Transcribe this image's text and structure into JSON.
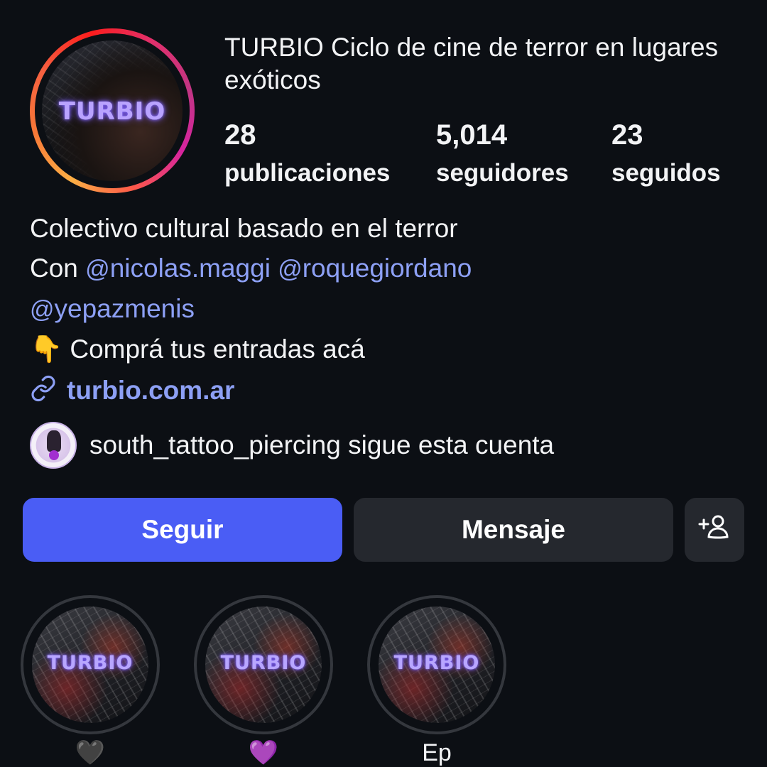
{
  "profile": {
    "avatar_logo_text": "TURBIO",
    "name": "TURBIO Ciclo de cine de terror en lugares exóticos",
    "stats": [
      {
        "value": "28",
        "label": "publicaciones"
      },
      {
        "value": "5,014",
        "label": "seguidores"
      },
      {
        "value": "23",
        "label": "seguidos"
      }
    ]
  },
  "bio": {
    "line1": "Colectivo cultural basado en el terror",
    "con_prefix": "Con",
    "mentions": [
      "nicolas.maggi",
      "roquegiordano",
      "yepazmenis"
    ],
    "threads_glyph": "@",
    "cta_emoji": "👇",
    "cta_text": "Comprá tus entradas acá"
  },
  "link": {
    "icon": "link-icon",
    "text": "turbio.com.ar"
  },
  "followed_by": {
    "text": "south_tattoo_piercing sigue esta cuenta"
  },
  "actions": {
    "follow": "Seguir",
    "message": "Mensaje",
    "add_user_icon": "add-user-icon"
  },
  "highlights": [
    {
      "logo": "TURBIO",
      "label": "🖤"
    },
    {
      "logo": "TURBIO",
      "label": "💜"
    },
    {
      "logo": "TURBIO",
      "label": "Ep"
    }
  ],
  "colors": {
    "background": "#0c0f14",
    "accent_link": "#8da0f5",
    "follow_button": "#4a5df5",
    "secondary_button": "#25282e"
  }
}
